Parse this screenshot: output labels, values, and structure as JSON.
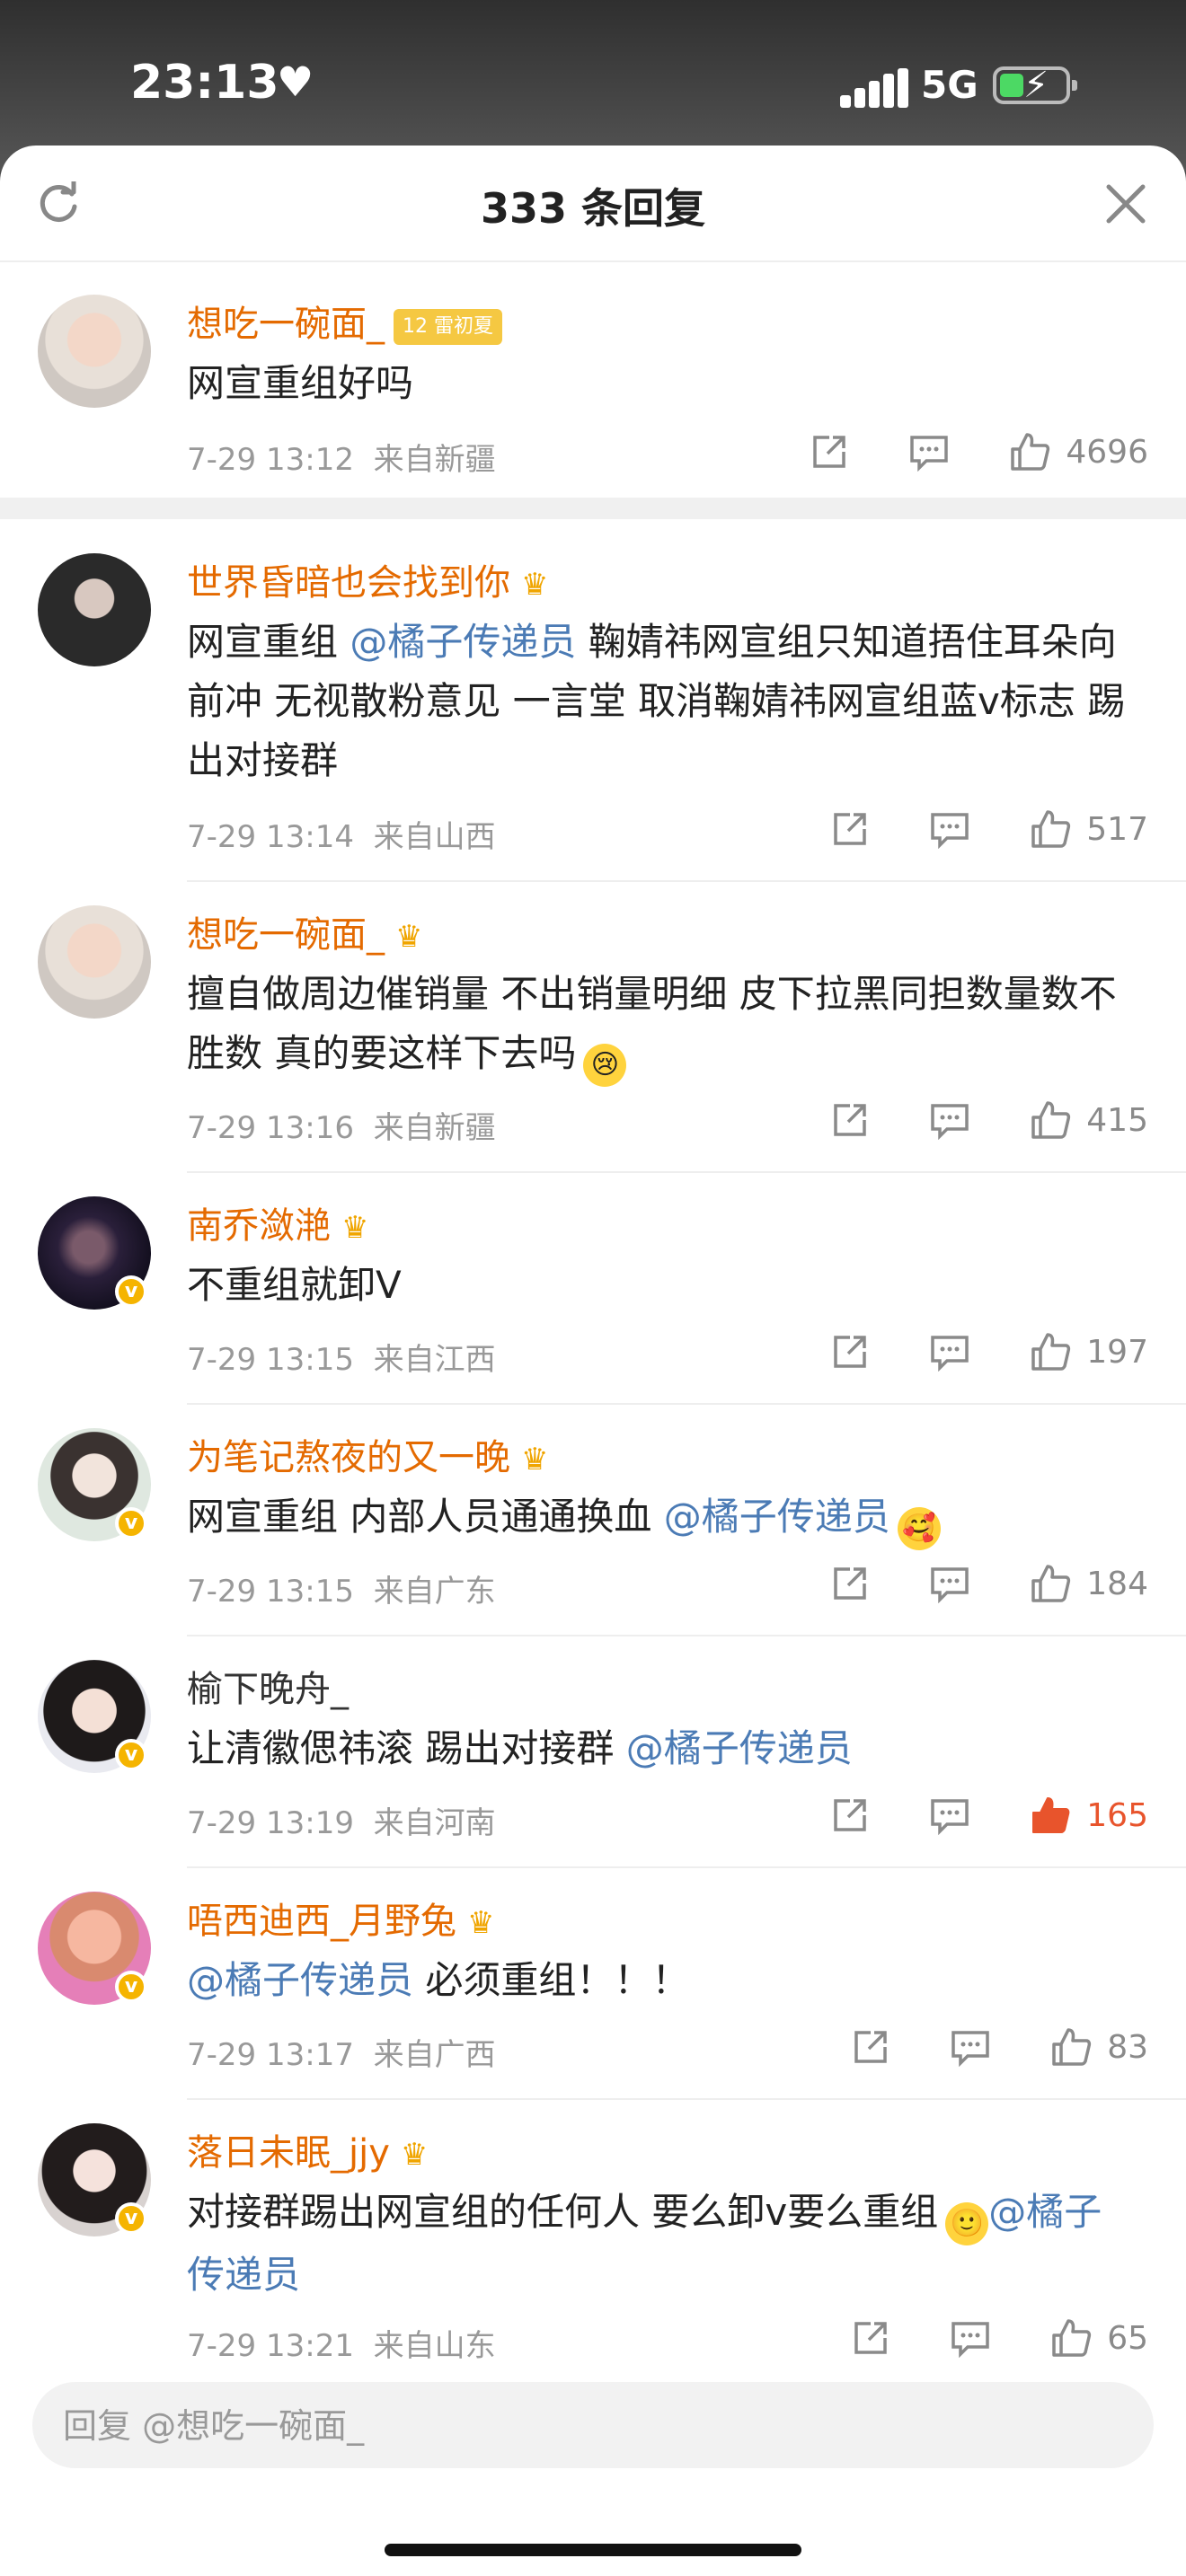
{
  "status_bar": {
    "time": "23:13",
    "network": "5G",
    "heart": "♥"
  },
  "header": {
    "title": "333 条回复"
  },
  "root_comment": {
    "username": "想吃一碗面_",
    "badge": "12 雷初夏",
    "text": "网宣重组好吗",
    "time": "7-29 13:12",
    "location": "来自新疆",
    "likes": "4696"
  },
  "replies": [
    {
      "username": "世界昏暗也会找到你",
      "text_parts": [
        "网宣重组 ",
        "@橘子传递员",
        " 鞠婧祎网宣组只知道捂住耳朵向前冲 无视散粉意见 一言堂 取消鞠婧祎网宣组蓝v标志 踢出对接群"
      ],
      "time": "7-29 13:14",
      "location": "来自山西",
      "likes": "517"
    },
    {
      "username": "想吃一碗面_",
      "text": "擅自做周边催销量 不出销量明细 皮下拉黑同担数量数不胜数 真的要这样下去吗",
      "time": "7-29 13:16",
      "location": "来自新疆",
      "likes": "415"
    },
    {
      "username": "南乔潋滟",
      "text": "不重组就卸V",
      "time": "7-29 13:15",
      "location": "来自江西",
      "likes": "197"
    },
    {
      "username": "为笔记熬夜的又一晚",
      "text": "网宣重组 内部人员通通换血 ",
      "mention": "@橘子传递员",
      "time": "7-29 13:15",
      "location": "来自广东",
      "likes": "184"
    },
    {
      "username": "榆下晚舟_",
      "text": "让清徽偲祎滚 踢出对接群 ",
      "mention": "@橘子传递员",
      "time": "7-29 13:19",
      "location": "来自河南",
      "likes": "165"
    },
    {
      "username": "唔西迪西_月野兔",
      "mention": "@橘子传递员",
      "text": " 必须重组！！！",
      "time": "7-29 13:17",
      "location": "来自广西",
      "likes": "83"
    },
    {
      "username": "落日未眠_jjy",
      "text": "对接群踢出网宣组的任何人 要么卸v要么重组",
      "mention": "@橘子传递员",
      "time": "7-29 13:21",
      "location": "来自山东",
      "likes": "65"
    }
  ],
  "reply_input": {
    "placeholder": "回复 @想吃一碗面_"
  },
  "colors": {
    "username": "#e46a00",
    "mention": "#4b7bb5",
    "like_active": "#e8542c"
  }
}
